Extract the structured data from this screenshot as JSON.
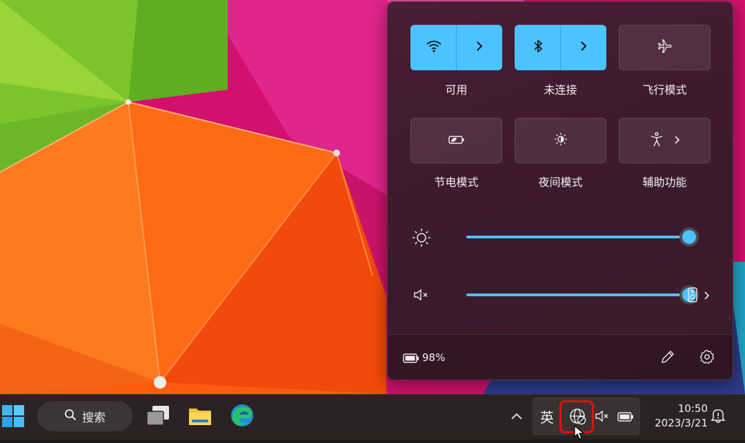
{
  "quick_settings": {
    "tiles": [
      {
        "label": "可用",
        "icon": "wifi-icon",
        "active": true
      },
      {
        "label": "未连接",
        "icon": "bluetooth-icon",
        "active": true
      },
      {
        "label": "飞行模式",
        "icon": "airplane-icon",
        "active": false
      },
      {
        "label": "节电模式",
        "icon": "battery-saver-icon",
        "active": false
      },
      {
        "label": "夜间模式",
        "icon": "night-light-icon",
        "active": false
      },
      {
        "label": "辅助功能",
        "icon": "accessibility-icon",
        "active": false
      }
    ],
    "brightness_level": 1.0,
    "volume_level": 1.0,
    "volume_muted": true,
    "battery_percent": "98%"
  },
  "taskbar": {
    "search_label": "搜索",
    "ime_label": "英",
    "time": "10:50",
    "date": "2023/3/21"
  },
  "colors": {
    "accent": "#4cc2ff",
    "highlight": "#e01010"
  }
}
